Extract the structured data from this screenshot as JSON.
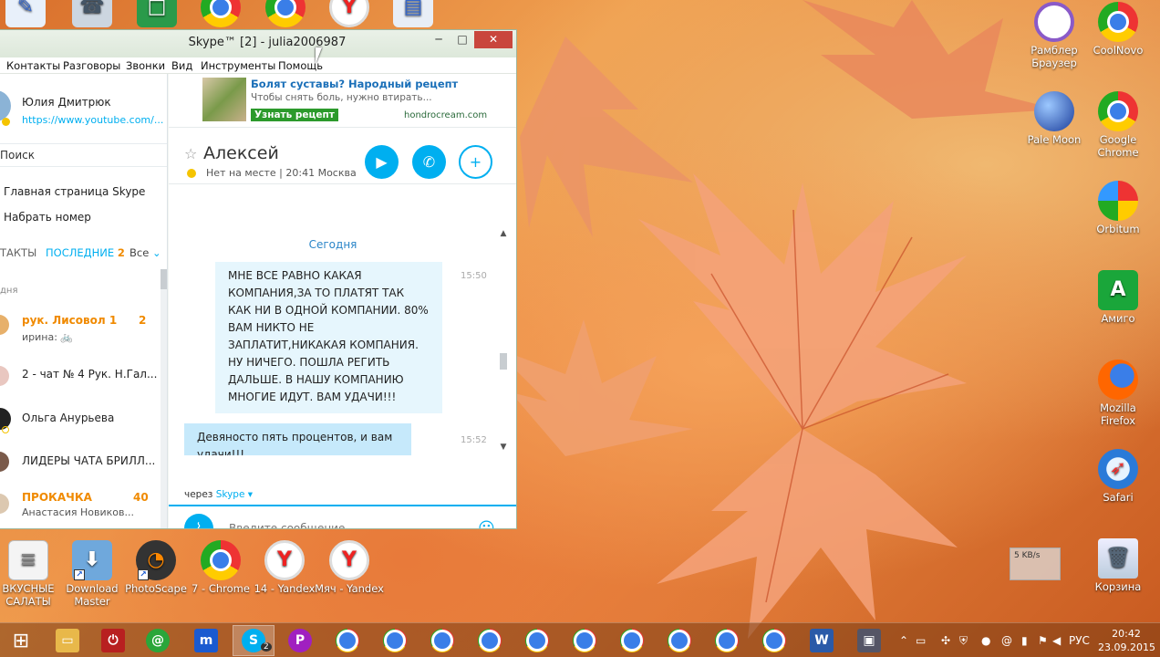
{
  "desktop": {
    "left_icons": [
      {
        "label": "ВКУСНЫЕ САЛАТЫ",
        "icon": "document-icon"
      },
      {
        "label": "Download Master",
        "icon": "download-master-icon"
      },
      {
        "label": "PhotoScape",
        "icon": "photoscape-icon"
      },
      {
        "label": "7 - Chrome",
        "icon": "chrome-icon"
      },
      {
        "label": "14 - Yandex",
        "icon": "yandex-icon"
      },
      {
        "label": "Мяч - Yandex",
        "icon": "yandex-icon"
      }
    ],
    "right_icons": [
      {
        "label": "Рамблер Браузер",
        "icon": "rambler-icon"
      },
      {
        "label": "CoolNovo",
        "icon": "coolnovo-icon"
      },
      {
        "label": "Pale Moon",
        "icon": "pale-moon-icon"
      },
      {
        "label": "Google Chrome",
        "icon": "chrome-icon"
      },
      {
        "label": "Orbitum",
        "icon": "orbitum-icon"
      },
      {
        "label": "Амиго",
        "icon": "amigo-icon"
      },
      {
        "label": "Mozilla Firefox",
        "icon": "firefox-icon"
      },
      {
        "label": "Safari",
        "icon": "safari-icon"
      },
      {
        "label": "Корзина",
        "icon": "recycle-bin-icon"
      }
    ],
    "net_widget": "5 KB/s"
  },
  "skype": {
    "title": "Skype™ [2] - julia2006987",
    "menu": [
      "Контакты",
      "Разговоры",
      "Звонки",
      "Вид",
      "Инструменты",
      "Помощь"
    ],
    "profile": {
      "name": "Юлия Дмитрюк",
      "status": "https://www.youtube.com/..."
    },
    "search": "Поиск",
    "nav": [
      "Главная страница Skype",
      "Набрать номер"
    ],
    "tabs": {
      "contacts": "ТАКТЫ",
      "recent": "ПОСЛЕДНИЕ",
      "recent_count": "2",
      "filter": "Все"
    },
    "section": "дня",
    "contacts": [
      {
        "name": "рук. Лисовол 1",
        "sub": "ирина:",
        "badge": "2",
        "highlight": true
      },
      {
        "name": "2 - чат № 4 Рук. Н.Гал...",
        "sub": "",
        "badge": "",
        "highlight": false
      },
      {
        "name": "Ольга Анурьева",
        "sub": "",
        "badge": "",
        "highlight": false
      },
      {
        "name": "ЛИДЕРЫ ЧАТА БРИЛЛ...",
        "sub": "",
        "badge": "",
        "highlight": false
      },
      {
        "name": "ПРОКАЧКА",
        "sub": "Анастасия Новиков...",
        "badge": "40",
        "highlight": true
      }
    ],
    "ad": {
      "headline": "Болят суставы? Народный рецепт",
      "text": "Чтобы снять боль, нужно втирать...",
      "button": "Узнать рецепт",
      "domain": "hondrocream.com"
    },
    "chat": {
      "contact": "Алексей",
      "status": "Нет на месте",
      "local_time": "20:41 Москва",
      "day": "Сегодня",
      "messages": [
        {
          "text": "МНЕ ВСЕ РАВНО КАКАЯ КОМПАНИЯ,ЗА ТО ПЛАТЯТ ТАК КАК НИ В ОДНОЙ КОМПАНИИ. 80% ВАМ НИКТО НЕ ЗАПЛАТИТ,НИКАКАЯ КОМПАНИЯ. НУ НИЧЕГО. ПОШЛА РЕГИТЬ ДАЛЬШЕ. В НАШУ КОМПАНИЮ МНОГИЕ ИДУТ. ВАМ УДАЧИ!!!",
          "time": "15:50"
        },
        {
          "text": "Девяносто пять процентов, и вам удачи!!!",
          "time": "15:52"
        }
      ],
      "via_prefix": "через",
      "via": "Skype",
      "input_placeholder": "Введите сообщение"
    }
  },
  "taskbar": {
    "skype_badge": "2",
    "lang": "РУС",
    "time": "20:42",
    "date": "23.09.2015"
  }
}
